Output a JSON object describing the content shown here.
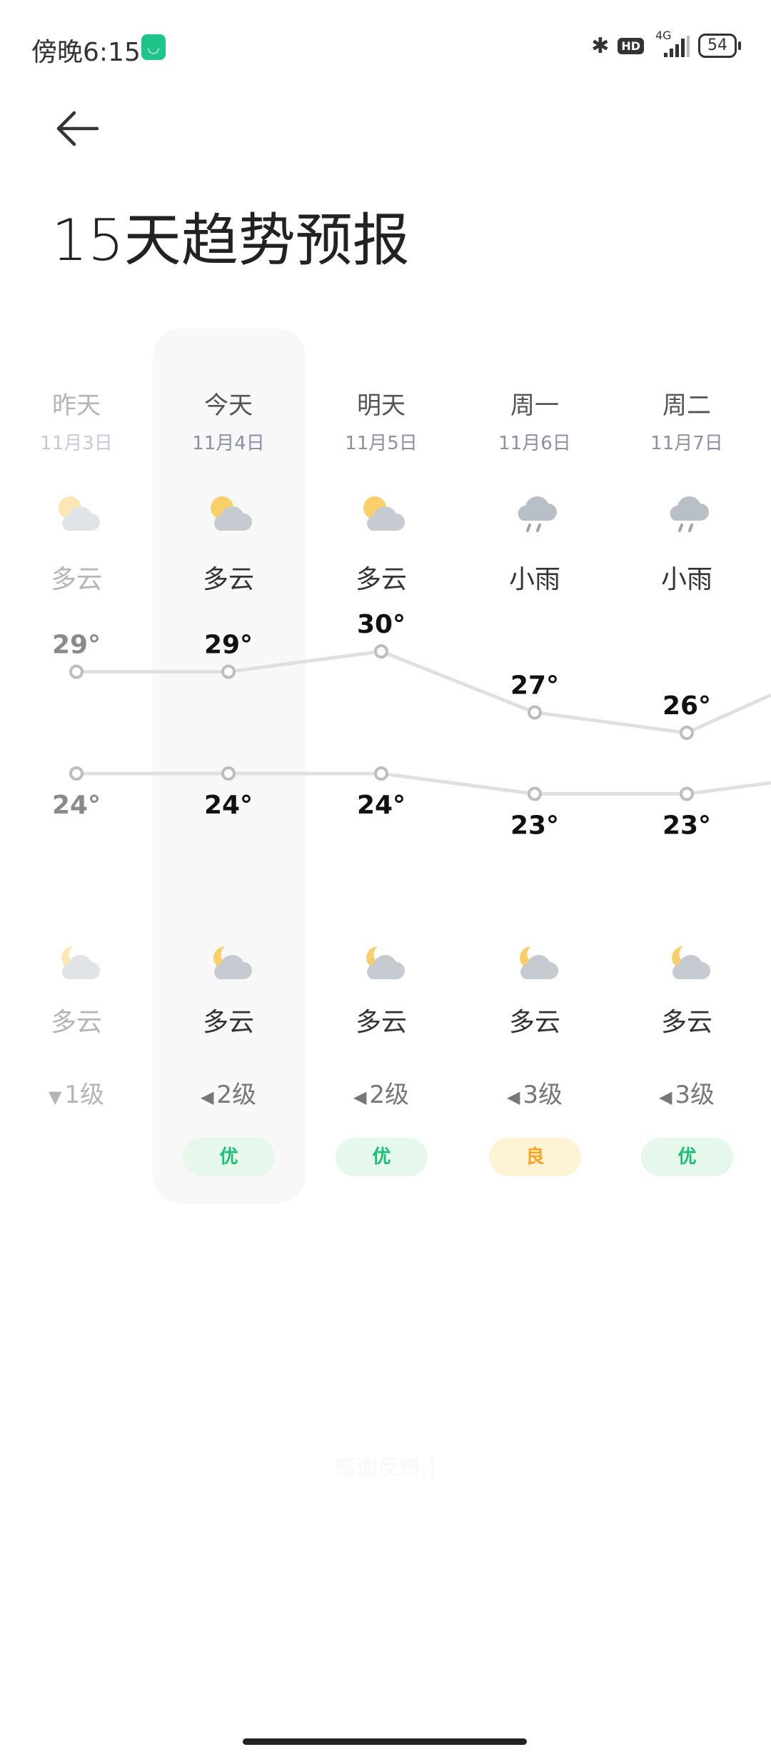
{
  "status_bar": {
    "time": "傍晚6:15",
    "network": "4G",
    "hd": "HD",
    "battery": "54",
    "app_badge": "mi-home-icon"
  },
  "header": {
    "title": "15天趋势预报",
    "back": "back-arrow-icon"
  },
  "days": [
    {
      "name": "昨天",
      "date": "11月3日",
      "day_icon": "partly-cloudy-day",
      "day_cond": "多云",
      "night_icon": "partly-cloudy-night",
      "night_cond": "多云",
      "wind": "1级",
      "wind_dir": "down",
      "aqi": "",
      "past": true
    },
    {
      "name": "今天",
      "date": "11月4日",
      "day_icon": "partly-cloudy-day",
      "day_cond": "多云",
      "night_icon": "partly-cloudy-night",
      "night_cond": "多云",
      "wind": "2级",
      "wind_dir": "left",
      "aqi": "优",
      "aqi_level": "good",
      "selected": true
    },
    {
      "name": "明天",
      "date": "11月5日",
      "day_icon": "partly-cloudy-day",
      "day_cond": "多云",
      "night_icon": "partly-cloudy-night",
      "night_cond": "多云",
      "wind": "2级",
      "wind_dir": "left",
      "aqi": "优",
      "aqi_level": "good"
    },
    {
      "name": "周一",
      "date": "11月6日",
      "day_icon": "light-rain",
      "day_cond": "小雨",
      "night_icon": "partly-cloudy-night",
      "night_cond": "多云",
      "wind": "3级",
      "wind_dir": "left",
      "aqi": "良",
      "aqi_level": "moderate"
    },
    {
      "name": "周二",
      "date": "11月7日",
      "day_icon": "light-rain",
      "day_cond": "小雨",
      "night_icon": "partly-cloudy-night",
      "night_cond": "多云",
      "wind": "3级",
      "wind_dir": "left",
      "aqi": "优",
      "aqi_level": "good"
    }
  ],
  "colors": {
    "aqi_good_bg": "#e6f8ec",
    "aqi_good_text": "#1cbf76",
    "aqi_moderate_bg": "#fff3d6",
    "aqi_moderate_text": "#f5a623",
    "line": "#e0e0e0"
  },
  "chart_data": {
    "type": "line",
    "categories": [
      "昨天",
      "今天",
      "明天",
      "周一",
      "周二"
    ],
    "series": [
      {
        "values": [
          29,
          29,
          30,
          27,
          26
        ]
      },
      {
        "values": [
          24,
          24,
          24,
          23,
          23
        ]
      }
    ],
    "unit": "°"
  },
  "footer": {
    "feedback": "感谢反馈:)"
  }
}
